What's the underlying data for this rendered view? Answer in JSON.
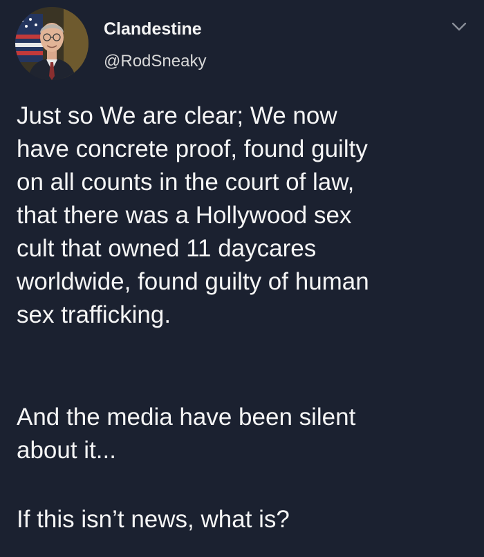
{
  "tweet": {
    "display_name": "Clandestine",
    "handle": "@RodSneaky",
    "paragraph1": [
      "Just so We are clear; We now",
      "have concrete proof, found guilty",
      "on all counts in the court of law,",
      "that there was a Hollywood sex",
      "cult that owned 11 daycares",
      "worldwide, found guilty of human",
      "sex trafficking."
    ],
    "paragraph2": [
      "And the media have been silent",
      "about it..."
    ],
    "paragraph3": [
      "If this isn’t news, what is?"
    ]
  },
  "icons": {
    "more_menu": "chevron-down-icon",
    "avatar": "avatar-photo"
  },
  "colors": {
    "background": "#1b2130",
    "text": "#f5f5f5",
    "handle": "#d8d8d8",
    "chevron": "#8a8f99"
  }
}
